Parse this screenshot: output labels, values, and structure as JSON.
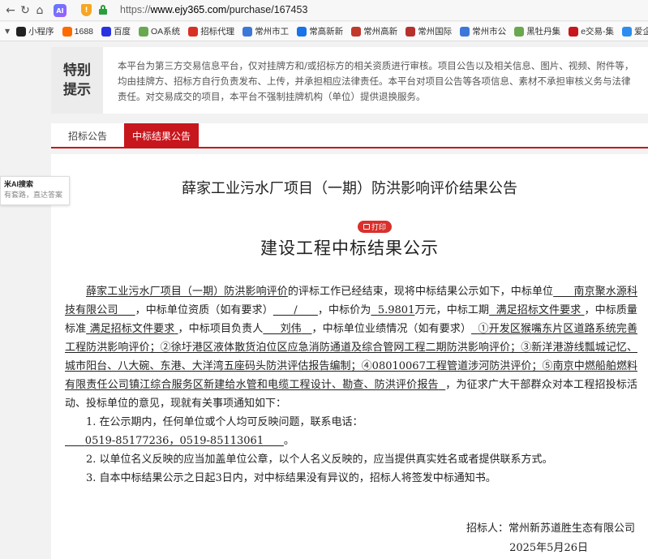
{
  "browser": {
    "url_proto": "https://",
    "url_host": "www.ejy365.com",
    "url_path": "/purchase/167453",
    "ai_badge": "AI",
    "shield_mark": "!"
  },
  "bookmarks": [
    {
      "label": "小程序",
      "icon_text": "",
      "color": "#222222"
    },
    {
      "label": "1688",
      "icon_text": "",
      "color": "#ff6a00"
    },
    {
      "label": "百度",
      "icon_text": "",
      "color": "#2932e1"
    },
    {
      "label": "OA系统",
      "icon_text": "",
      "color": "#6aa84f"
    },
    {
      "label": "招标代理",
      "icon_text": "",
      "color": "#d93025"
    },
    {
      "label": "常州市工",
      "icon_text": "",
      "color": "#3c78d8"
    },
    {
      "label": "常高新新",
      "icon_text": "",
      "color": "#1a73e8"
    },
    {
      "label": "常州高新",
      "icon_text": "",
      "color": "#c0392b"
    },
    {
      "label": "常州国际",
      "icon_text": "",
      "color": "#b7312c"
    },
    {
      "label": "常州市公",
      "icon_text": "",
      "color": "#3c78d8"
    },
    {
      "label": "黑牡丹集",
      "icon_text": "",
      "color": "#6aa84f"
    },
    {
      "label": "e交易-集",
      "icon_text": "",
      "color": "#c8161d"
    },
    {
      "label": "爱企查首",
      "icon_text": "",
      "color": "#2d8cf0"
    }
  ],
  "ai_panel": {
    "title": "米AI搜索",
    "subtitle": "有套路，直达答案"
  },
  "notice": {
    "label_line1": "特别",
    "label_line2": "提示",
    "text": "本平台为第三方交易信息平台，仅对挂牌方和/或招标方的相关资质进行审核。项目公告以及相关信息、图片、视频、附件等，均由挂牌方、招标方自行负责发布、上传，并承担相应法律责任。本平台对项目公告等各项信息、素材不承担审核义务与法律责任。对交易成交的项目，本平台不强制挂牌机构（单位）提供退换服务。"
  },
  "tabs": [
    {
      "label": "招标公告",
      "active": false
    },
    {
      "label": "中标结果公告",
      "active": true
    }
  ],
  "page_title": "薛家工业污水厂项目（一期）防洪影响评价结果公告",
  "print_label": "打印",
  "doc_heading": "建设工程中标结果公示",
  "body": {
    "project_name": "薛家工业污水厂项目（一期）防洪影响评价",
    "p1_a": "的评标工作已经结束，现将中标结果公示如下，中标单位",
    "winner": "南京聚水源科技有限公司",
    "p1_b": "，中标单位资质（如有要求）",
    "qualification": "/",
    "p1_c": "，中标价为",
    "price": "5.9801",
    "price_unit": "万元，中标工期",
    "duration": "满足招标文件要求",
    "p1_d": "，中标质量标准",
    "quality": "满足招标文件要求",
    "p1_e": "，中标项目负责人",
    "manager": "刘伟",
    "p1_f": "，中标单位业绩情况（如有要求）",
    "performance": "①开发区猴嘴东片区道路系统完善工程防洪影响评价；②徐圩港区液体散货泊位区应急消防通道及综合管网工程二期防洪影响评价；③新洋港游线瓢城记忆、城市阳台、八大碗、东港、大洋湾五座码头防洪评估报告编制；④08010067工程管道涉河防洪评价；⑤南京中燃船舶燃料有限责任公司镇江综合服务区新建给水管和电缆工程设计、勘查、防洪评价报告",
    "p1_g": "，为征求广大干部群众对本工程招投标活动、投标单位的意见，现就有关事项通知如下：",
    "item1": "1. 在公示期内，任何单位或个人均可反映问题，联系电话：",
    "phones": "0519-85177236，0519-85113061",
    "phones_end": "。",
    "item2": "2. 以单位名义反映的应当加盖单位公章，以个人名义反映的，应当提供真实姓名或者提供联系方式。",
    "item3": "3. 自本中标结果公示之日起3日内，对中标结果没有异议的，招标人将签发中标通知书。"
  },
  "signature": {
    "issuer": "招标人：常州新苏道胜生态有限公司",
    "date": "2025年5月26日"
  }
}
